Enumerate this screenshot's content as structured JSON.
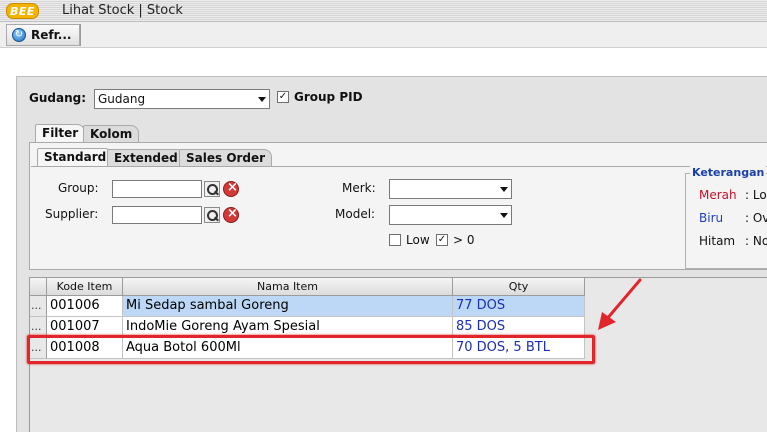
{
  "window": {
    "logo": "BEE",
    "title": "Lihat Stock | Stock"
  },
  "toolbar": {
    "refresh_label": "Refr..."
  },
  "header": {
    "gudang_label": "Gudang:",
    "gudang_value": "Gudang",
    "group_pid_label": "Group PID",
    "group_pid_checked": true
  },
  "tabs_outer": [
    {
      "label": "Filter"
    },
    {
      "label": "Kolom"
    }
  ],
  "tabs_inner": [
    {
      "label": "Standard"
    },
    {
      "label": "Extended"
    },
    {
      "label": "Sales Order"
    }
  ],
  "filter": {
    "group_label": "Group:",
    "supplier_label": "Supplier:",
    "merk_label": "Merk:",
    "model_label": "Model:",
    "low_label": "Low",
    "low_checked": false,
    "gt_zero_label": "> 0",
    "gt_zero_checked": true
  },
  "keterangan": {
    "title": "Keterangan",
    "items": [
      {
        "name": "Merah",
        "desc": ": Lo",
        "color": "#c8102e"
      },
      {
        "name": "Biru",
        "desc": ": Ov",
        "color": "#1f3fbf"
      },
      {
        "name": "Hitam",
        "desc": ": No",
        "color": "#111111"
      }
    ]
  },
  "grid": {
    "columns": [
      {
        "label": "Kode Item"
      },
      {
        "label": "Nama Item"
      },
      {
        "label": "Qty"
      }
    ],
    "rows": [
      {
        "handle": "...",
        "kode": "001006",
        "nama": "Mi Sedap sambal Goreng",
        "qty": "77 DOS",
        "selected": true
      },
      {
        "handle": "...",
        "kode": "001007",
        "nama": "IndoMie Goreng Ayam Spesial",
        "qty": "85 DOS",
        "selected": false
      },
      {
        "handle": "...",
        "kode": "001008",
        "nama": "Aqua Botol 600Ml",
        "qty": "70 DOS, 5 BTL",
        "selected": false
      }
    ]
  },
  "colors": {
    "selected_row": "#bcd8f6",
    "highlight": "#e0262b",
    "qty_text": "#1c2fb0"
  }
}
